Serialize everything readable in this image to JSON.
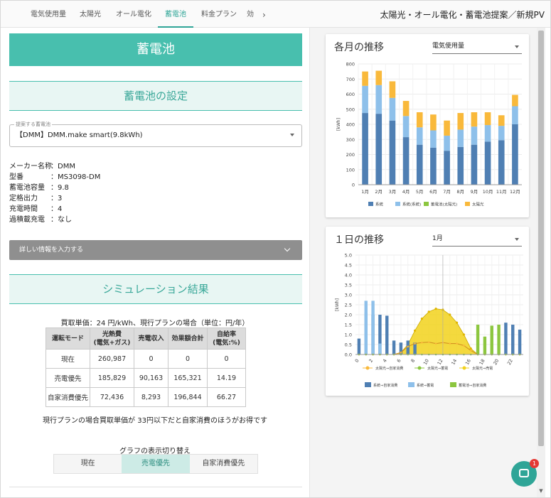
{
  "nav": {
    "tabs": [
      "電気使用量",
      "太陽光",
      "オール電化",
      "蓄電池",
      "料金プラン",
      "効"
    ],
    "active_tab": "蓄電池",
    "more_icon": "chevron-right-icon"
  },
  "page_title": "太陽光・オール電化・蓄電池提案／新規PV",
  "left": {
    "banner": "蓄電池",
    "settings_title": "蓄電池の設定",
    "battery_select": {
      "legend": "提案する蓄電池",
      "value": "【DMM】DMM.make smart(9.8kWh)"
    },
    "specs": [
      {
        "key": "メーカー名称",
        "value": "：DMM"
      },
      {
        "key": "型番",
        "value": "：MS3098-DM"
      },
      {
        "key": "蓄電池容量",
        "value": "：9.8"
      },
      {
        "key": "定格出力",
        "value": "：3"
      },
      {
        "key": "充電時間",
        "value": "：4"
      },
      {
        "key": "過積載充電",
        "value": "：なし"
      }
    ],
    "details_label": "詳しい情報を入力する",
    "sim_title": "シミュレーション結果",
    "sim_note": "買取単価：24 円/kWh、現行プランの場合（単位：円/年）",
    "table": {
      "headers": [
        "運転モード",
        "光熱費\n(電気+ガス)",
        "売電収入",
        "効果額合計",
        "自給率\n(電気:%)"
      ],
      "rows": [
        [
          "現在",
          "260,987",
          "0",
          "0",
          "0"
        ],
        [
          "売電優先",
          "185,829",
          "90,163",
          "165,321",
          "14.19"
        ],
        [
          "自家消費優先",
          "72,436",
          "8,293",
          "196,844",
          "66.27"
        ]
      ]
    },
    "conclusion": "現行プランの場合買取単価が 33円以下だと自家消費のほうがお得です",
    "toggle_label": "グラフの表示切り替え",
    "toggle_options": [
      "現在",
      "売電優先",
      "自家消費優先"
    ],
    "toggle_selected": "売電優先"
  },
  "monthly_card": {
    "title": "各月の推移",
    "select_value": "電気使用量"
  },
  "daily_card": {
    "title": "１日の推移",
    "select_value": "1月"
  },
  "chat": {
    "icon": "chat-icon",
    "badge": "1"
  },
  "colors": {
    "accent": "#48bfae",
    "grid_purchase": "#4f7fb3",
    "grid_storage": "#8ec0ea",
    "solar_storage": "#8cc63f",
    "solar": "#f9b93b",
    "solar_line": "#f2d21c"
  },
  "chart_data": [
    {
      "type": "bar",
      "title": "各月の推移",
      "ylabel": "[kWh]",
      "ylim": [
        0,
        800
      ],
      "yticks": [
        0,
        100,
        200,
        300,
        400,
        500,
        600,
        700,
        800
      ],
      "categories": [
        "1月",
        "2月",
        "3月",
        "4月",
        "5月",
        "6月",
        "7月",
        "8月",
        "9月",
        "10月",
        "11月",
        "12月"
      ],
      "stacked": true,
      "legend_position": "bottom",
      "series": [
        {
          "name": "系統",
          "color": "#4f7fb3",
          "values": [
            475,
            470,
            425,
            315,
            265,
            245,
            225,
            250,
            265,
            285,
            295,
            400
          ]
        },
        {
          "name": "系統(系統)",
          "color": "#8ec0ea",
          "values": [
            180,
            190,
            150,
            140,
            115,
            115,
            100,
            115,
            120,
            110,
            95,
            120
          ]
        },
        {
          "name": "蓄電池(太陽光)",
          "color": "#8cc63f",
          "values": [
            0,
            0,
            0,
            0,
            0,
            0,
            0,
            0,
            0,
            0,
            0,
            0
          ]
        },
        {
          "name": "太陽光",
          "color": "#f9b93b",
          "values": [
            95,
            95,
            110,
            100,
            100,
            105,
            100,
            110,
            95,
            85,
            70,
            75
          ]
        }
      ]
    },
    {
      "type": "bar",
      "title": "１日の推移",
      "ylabel": "[kWh]",
      "ylim": [
        0,
        5.0
      ],
      "yticks": [
        0,
        0.5,
        1.0,
        1.5,
        2.0,
        2.5,
        3.0,
        3.5,
        4.0,
        4.5,
        5.0
      ],
      "x": [
        0,
        1,
        2,
        3,
        4,
        5,
        6,
        7,
        8,
        9,
        10,
        11,
        12,
        13,
        14,
        15,
        16,
        17,
        18,
        19,
        20,
        21,
        22,
        23
      ],
      "xticks": [
        0,
        2,
        4,
        6,
        8,
        10,
        12,
        14,
        16,
        18,
        20,
        22
      ],
      "legend_position": "bottom",
      "series": [
        {
          "name": "系統⇒自家消費",
          "kind": "bar",
          "color": "#4f7fb3",
          "values": [
            0.8,
            2.1,
            2.0,
            2.0,
            1.95,
            0.7,
            0.6,
            0.7,
            0.6,
            0,
            0,
            0,
            0,
            0,
            0,
            0,
            0,
            0,
            0,
            0,
            0,
            1.6,
            1.5,
            1.25
          ]
        },
        {
          "name": "系統⇒蓄電",
          "kind": "bar",
          "color": "#8ec0ea",
          "values": [
            0,
            2.7,
            2.7,
            0.55,
            0,
            0,
            0,
            0,
            0,
            0,
            0,
            0,
            0,
            0,
            0,
            0,
            0,
            0,
            0,
            0,
            0,
            0,
            0,
            0
          ]
        },
        {
          "name": "蓄電池⇒自家消費",
          "kind": "bar",
          "color": "#8cc63f",
          "values": [
            0,
            0,
            0,
            0,
            0,
            0,
            0,
            0,
            0,
            0,
            0,
            0,
            0,
            0,
            0,
            0,
            0,
            1.5,
            0.9,
            1.45,
            1.5,
            0,
            0,
            0
          ]
        },
        {
          "name": "太陽光⇒自家消費",
          "kind": "line",
          "color": "#f9b93b",
          "values": [
            0,
            0,
            0,
            0,
            0,
            0,
            0.1,
            0.4,
            0.55,
            0.6,
            0.62,
            0.55,
            0.6,
            0.55,
            0.55,
            0.45,
            0.2,
            0,
            0,
            0,
            0,
            0,
            0,
            0
          ]
        },
        {
          "name": "太陽光⇒蓄電",
          "kind": "line",
          "color": "#8cc63f",
          "values": [
            0,
            0,
            0,
            0,
            0,
            0,
            0,
            0,
            0,
            0,
            0,
            0,
            0,
            0,
            0,
            0,
            0,
            0,
            0,
            0,
            0,
            0,
            0,
            0
          ]
        },
        {
          "name": "太陽光⇒売電",
          "kind": "area",
          "color": "#f2d21c",
          "values": [
            0,
            0,
            0,
            0,
            0,
            0,
            0.1,
            0.5,
            1.2,
            1.8,
            2.15,
            2.3,
            2.25,
            2.0,
            1.6,
            1.0,
            0.3,
            0,
            0,
            0,
            0,
            0,
            0,
            0
          ]
        }
      ]
    }
  ]
}
